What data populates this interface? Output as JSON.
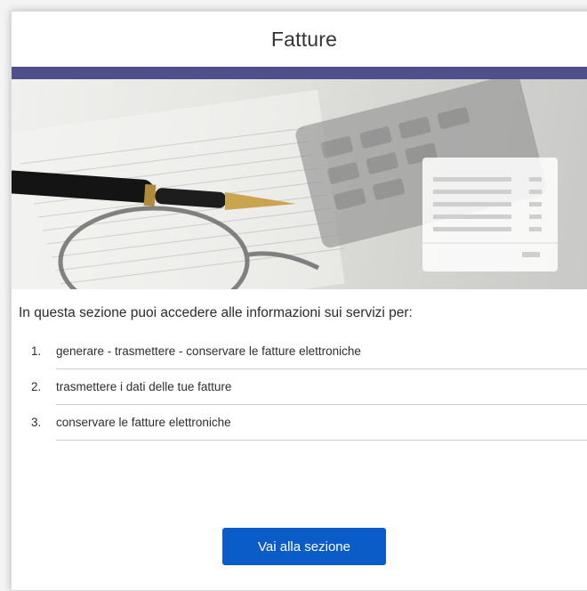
{
  "header": {
    "title": "Fatture"
  },
  "colors": {
    "accent_bar": "#514e8c",
    "button": "#0a5dc8"
  },
  "hero": {
    "image_icon": "invoice-desk-illustration"
  },
  "intro": "In questa sezione puoi accedere alle informazioni sui servizi per:",
  "services": [
    {
      "num": "1.",
      "label": "generare - trasmettere - conservare le fatture elettroniche"
    },
    {
      "num": "2.",
      "label": "trasmettere i dati delle tue fatture"
    },
    {
      "num": "3.",
      "label": "conservare le fatture elettroniche"
    }
  ],
  "cta": {
    "label": "Vai alla sezione"
  }
}
